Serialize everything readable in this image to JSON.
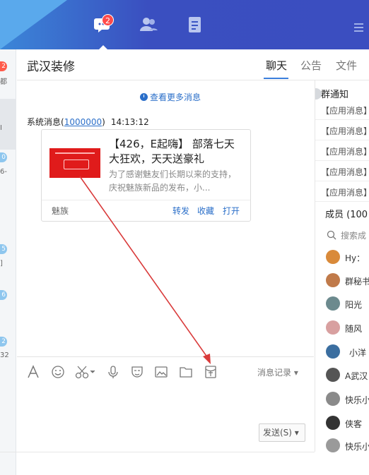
{
  "topbar": {
    "chat_badge": "2",
    "icons": [
      "chat-icon",
      "contacts-icon",
      "document-icon",
      "menu-icon"
    ]
  },
  "left_list": {
    "badges": [
      "2",
      "0",
      "5",
      "6",
      "2"
    ],
    "snippets": [
      "都",
      "I",
      "6-",
      "]",
      "32"
    ]
  },
  "chat": {
    "title": "武汉装修",
    "tabs": [
      "聊天",
      "公告",
      "文件"
    ],
    "more_messages": "查看更多消息",
    "sender": "系统消息",
    "sender_id_open": "(",
    "sender_id": "1000000",
    "sender_id_close": ")",
    "time": "14:13:12",
    "card": {
      "title": "【426，E起嗨】 部落七天大狂欢，天天送豪礼",
      "desc": "为了感谢魅友们长期以来的支持，庆祝魅族新品的发布，小...",
      "source": "魅族",
      "actions": [
        "转发",
        "收藏",
        "打开"
      ]
    }
  },
  "input": {
    "tools": [
      "font-icon",
      "emoji-icon",
      "scissors-icon",
      "mic-icon",
      "mask-icon",
      "image-icon",
      "folder-icon",
      "red-envelope-icon"
    ],
    "message_record": "消息记录 ▾",
    "send": "发送(S) ▾"
  },
  "right_panel": {
    "notice_title": "群通知",
    "notices": [
      "【应用消息】",
      "【应用消息】",
      "【应用消息】",
      "【应用消息】",
      "【应用消息】"
    ],
    "members_title": "成员 (100",
    "search": "搜索成",
    "members": [
      {
        "name": "Hy：",
        "color": "#d98a3a"
      },
      {
        "name": "群秘书",
        "color": "#c07a4a"
      },
      {
        "name": "阳光",
        "color": "#6c8a8e"
      },
      {
        "name": "随风",
        "color": "#d8a0a0"
      },
      {
        "name": "小洋",
        "color": "#3b6ea0"
      },
      {
        "name": "A武汉",
        "color": "#555555"
      },
      {
        "name": "快乐小",
        "color": "#8a8a8a"
      },
      {
        "name": "侠客",
        "color": "#333333"
      },
      {
        "name": "快乐小",
        "color": "#9a9a9a"
      }
    ]
  },
  "colors": {
    "accent": "#3b7fdc",
    "link": "#2b6fc9",
    "annotation_arrow": "#d93a3a"
  }
}
